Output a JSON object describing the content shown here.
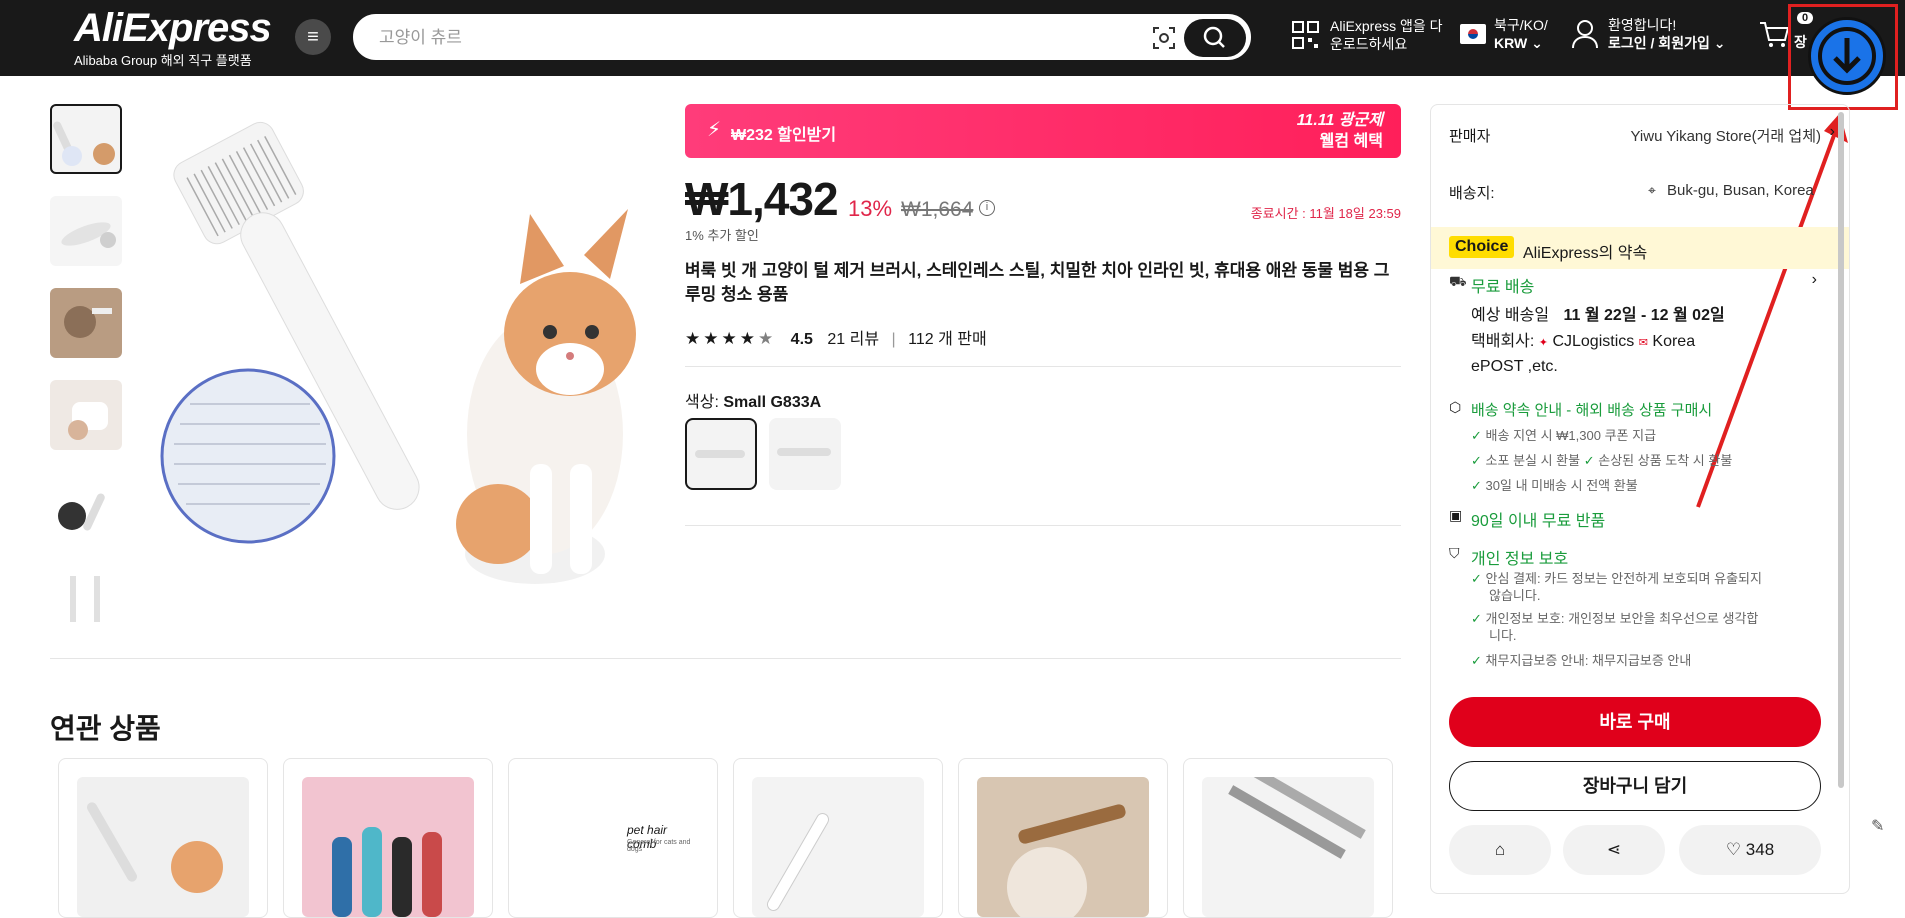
{
  "header": {
    "logo": "AliExpress",
    "logo_sub": "Alibaba Group 해외 직구 플랫폼",
    "search_placeholder": "고양이 츄르",
    "app_line1": "AliExpress 앱을 다",
    "app_line2": "운로드하세요",
    "region_line1": "북구/KO/",
    "region_line2": "KRW",
    "welcome": "환영합니다!",
    "login": "로그인 / 회원가입",
    "cart_count": "0",
    "cart_label": "장"
  },
  "product": {
    "promo_coupon": "₩232 할인받기",
    "promo_event_line1": "11.11 광군제",
    "promo_event_line2": "웰컴 혜택",
    "price": "₩1,432",
    "discount_pct": "13%",
    "original_price": "₩1,664",
    "extra_discount": "1% 추가 할인",
    "end_time": "종료시간 : 11월 18일 23:59",
    "title": "벼룩 빗 개 고양이 털 제거 브러시, 스테인레스 스틸, 치밀한 치아 인라인 빗, 휴대용 애완 동물 범용 그루밍 청소 용품",
    "rating": "4.5",
    "stars": 4.5,
    "reviews": "21 리뷰",
    "sold": "112 개 판매",
    "color_label": "색상:",
    "color_value": "Small G833A"
  },
  "panel": {
    "seller_label": "판매자",
    "seller_value": "Yiwu Yikang Store(거래 업체)",
    "ship_from_label": "배송지:",
    "ship_from_value": "Buk-gu, Busan, Korea",
    "choice_tag": "Choice",
    "choice_text": "AliExpress의 약속",
    "free_shipping": "무료 배송",
    "est_label": "예상 배송일",
    "est_value": "11 월 22일 - 12 월 02일",
    "carrier_label": "택배회사:",
    "carrier_1": "CJLogistics",
    "carrier_2": "Korea",
    "carrier_3": "ePOST ,etc.",
    "promise_title": "배송 약속 안내 - 해외 배송 상품 구매시",
    "promise_1": "배송 지연 시 ₩1,300 쿠폰 지급",
    "promise_2a": "소포 분실 시 환불",
    "promise_2b": "손상된 상품 도착 시 환불",
    "promise_3": "30일 내 미배송 시 전액 환불",
    "returns": "90일 이내 무료 반품",
    "privacy": "개인 정보 보호",
    "privacy_1a": "안심 결제: 카드 정보는 안전하게 보호되며 유출되지",
    "privacy_1b": "않습니다.",
    "privacy_2a": "개인정보 보호: 개인정보 보안을 최우선으로 생각합",
    "privacy_2b": "니다.",
    "privacy_3": "채무지급보증 안내: 채무지급보증 안내",
    "buy_now": "바로 구매",
    "add_cart": "장바구니 담기",
    "wishlist_count": "348"
  },
  "related": {
    "title": "연관 상품",
    "card3_text": "pet hair comb",
    "card3_sub": "General for cats and dogs"
  },
  "colors": {
    "accent_red": "#e0001b",
    "promo_pink": "#ff1f5a",
    "green": "#1a9c3c",
    "choice_yellow": "#ffdd00"
  }
}
